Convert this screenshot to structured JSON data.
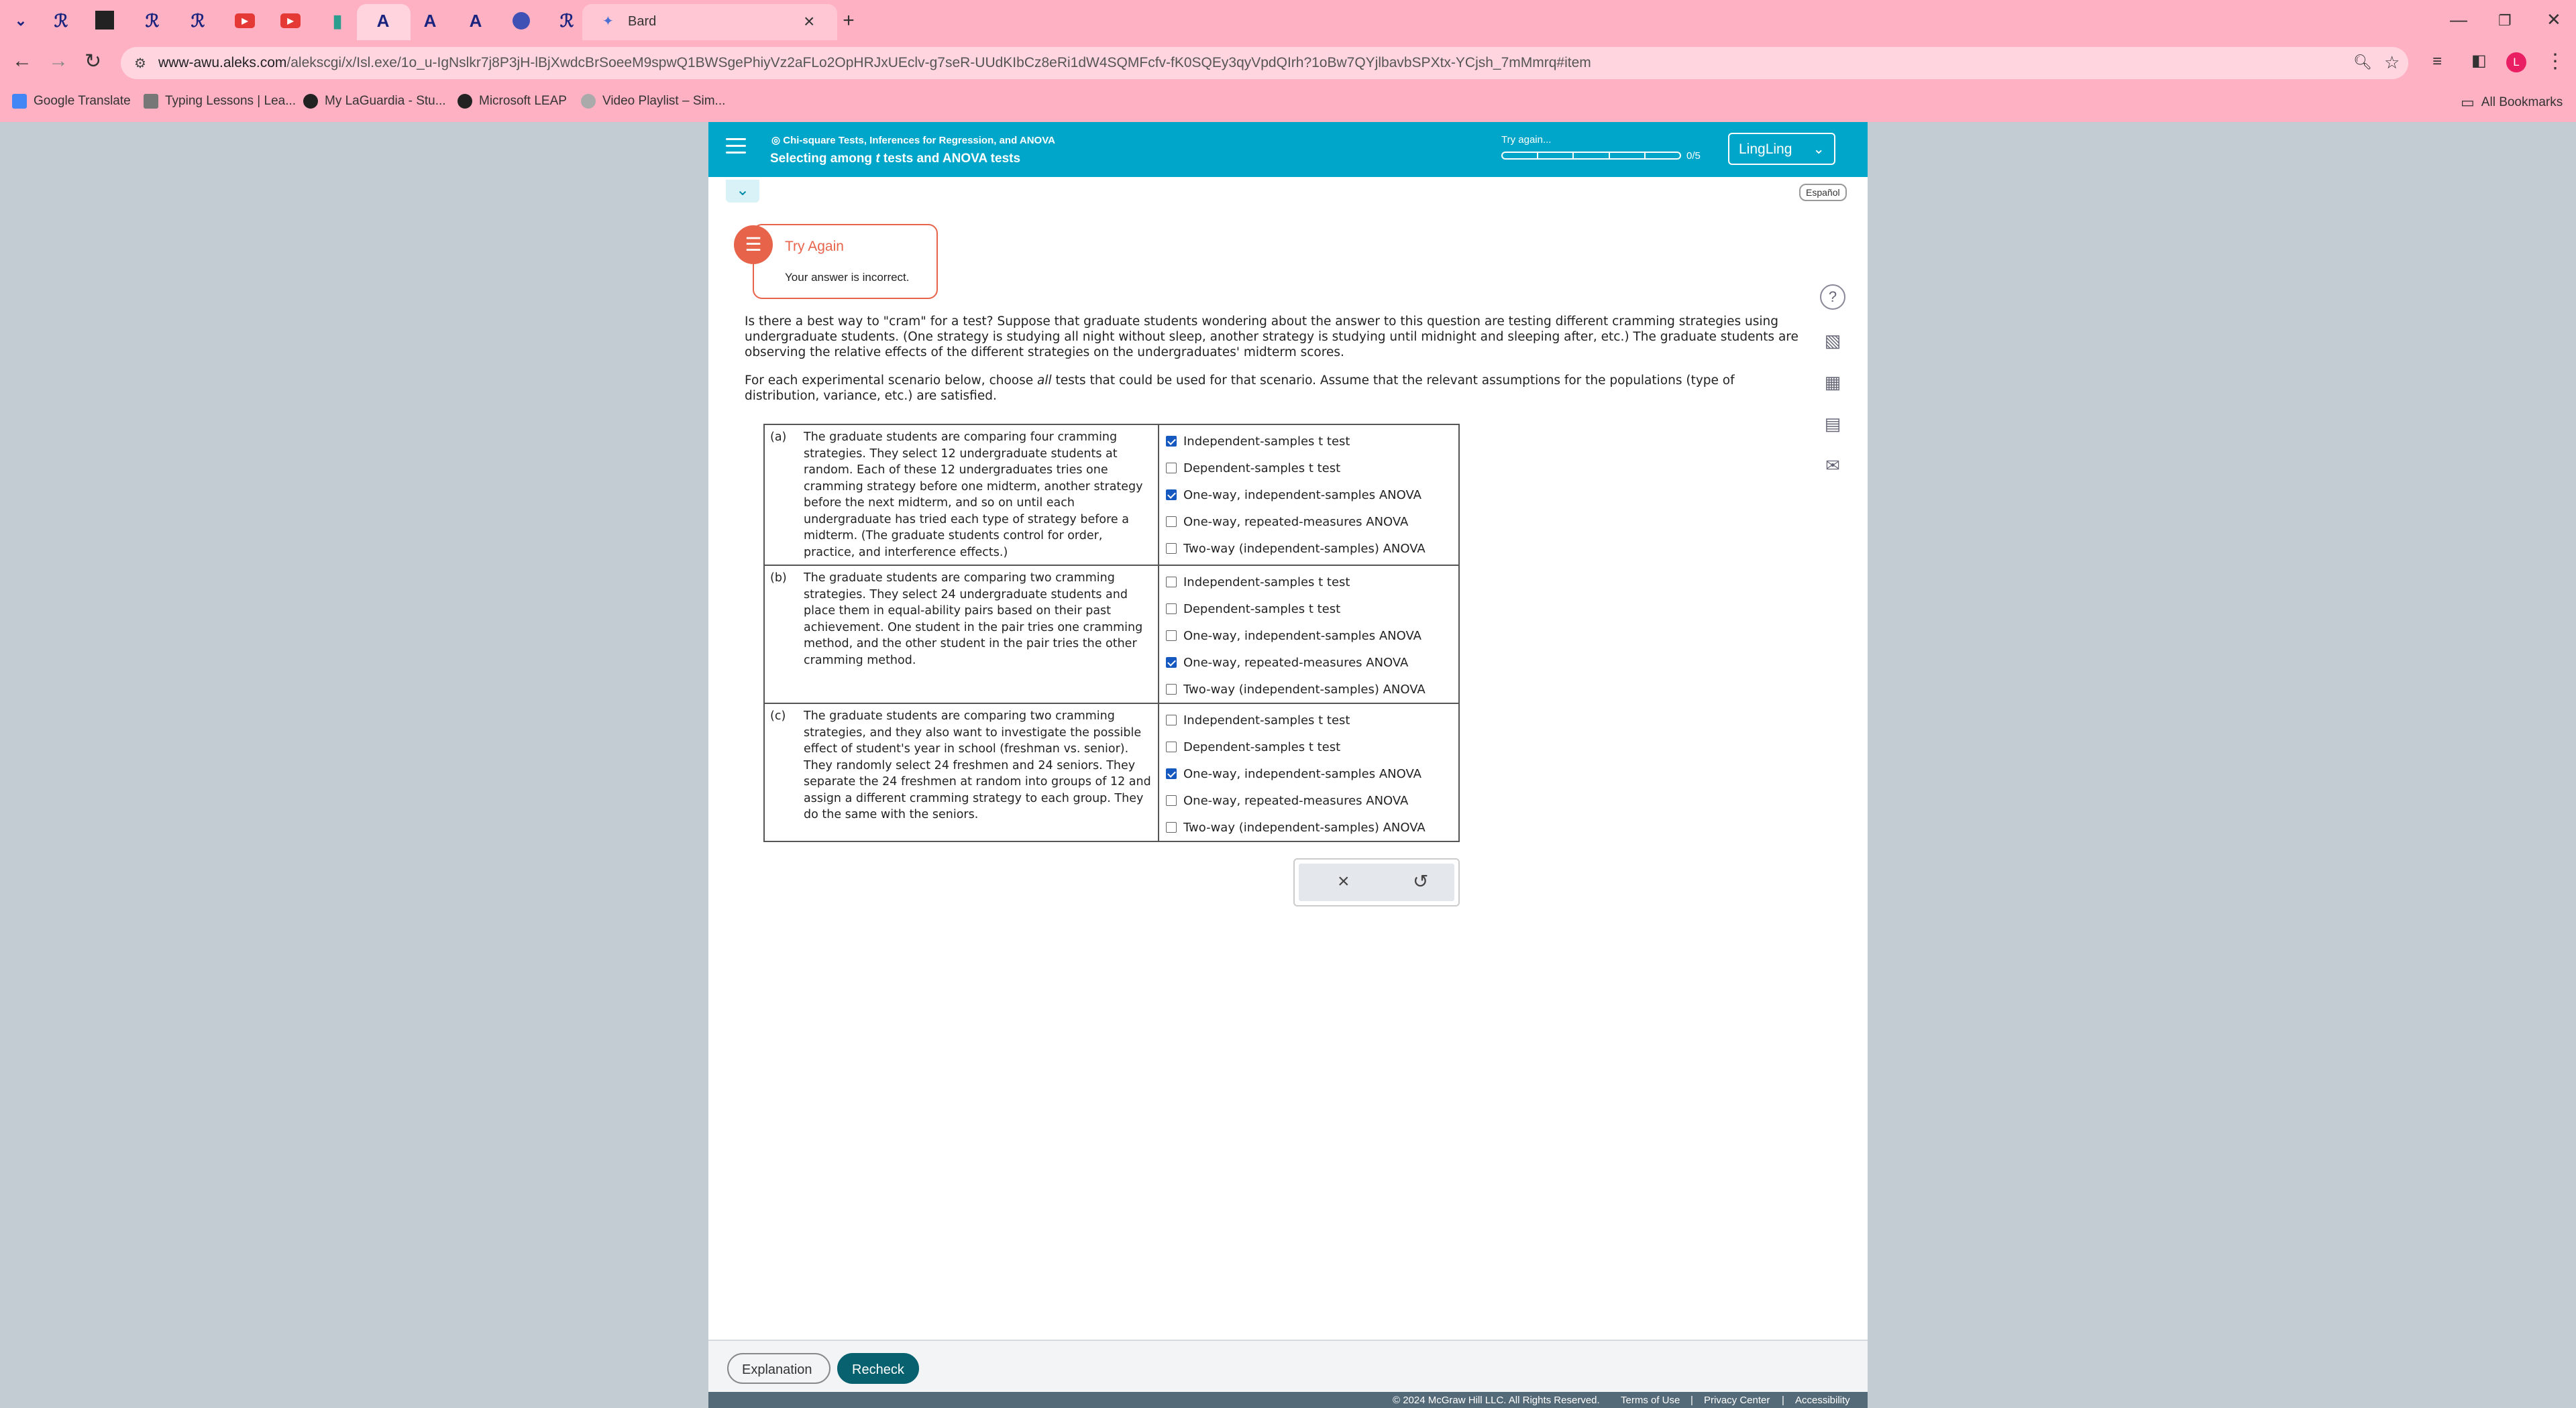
{
  "browser": {
    "tabs": [
      {
        "label": "Bard"
      }
    ],
    "url": {
      "host": "www-awu.aleks.com",
      "path": "/alekscgi/x/Isl.exe/1o_u-IgNslkr7j8P3jH-lBjXwdcBrSoeeM9spwQ1BWSgePhiyVz2aFLo2OpHRJxUEclv-g7seR-UUdKIbCz8eRi1dW4SQMFcfv-fK0SQEy3qyVpdQIrh?1oBw7QYjlbavbSPXtx-YCjsh_7mMmrq#item"
    },
    "bookmarks": [
      "Google Translate",
      "Typing Lessons | Lea...",
      "My LaGuardia - Stu...",
      "Microsoft LEAP",
      "Video Playlist – Sim..."
    ],
    "all_bookmarks": "All Bookmarks",
    "profile_initial": "L"
  },
  "header": {
    "topic": "Chi-square Tests, Inferences for Regression, and ANOVA",
    "title_pre": "Selecting among ",
    "title_t": "t",
    "title_post": " tests and ANOVA tests",
    "status": "Try again...",
    "progress": "0/5",
    "progress_value": 0,
    "user": "LingLing",
    "language": "Español"
  },
  "feedback": {
    "heading": "Try Again",
    "message": "Your answer is incorrect."
  },
  "question": {
    "intro": "Is there a best way to \"cram\" for a test? Suppose that graduate students wondering about the answer to this question are testing different cramming strategies using undergraduate students. (One strategy is studying all night without sleep, another strategy is studying until midnight and sleeping after, etc.) The graduate students are observing the relative effects of the different strategies on the undergraduates' midterm scores.",
    "instr_pre": "For each experimental scenario below, choose ",
    "instr_em": "all",
    "instr_post": " tests that could be used for that scenario. Assume that the relevant assumptions for the populations (type of distribution, variance, etc.) are satisfied."
  },
  "scenarios": [
    {
      "label": "(a)",
      "text": "The graduate students are comparing four cramming strategies. They select 12 undergraduate students at random. Each of these 12 undergraduates tries one cramming strategy before one midterm, another strategy before the next midterm, and so on until each undergraduate has tried each type of strategy before a midterm. (The graduate students control for order, practice, and interference effects.)",
      "options": [
        {
          "label": "Independent-samples t test",
          "checked": true
        },
        {
          "label": "Dependent-samples t test",
          "checked": false
        },
        {
          "label": "One-way, independent-samples ANOVA",
          "checked": true
        },
        {
          "label": "One-way, repeated-measures ANOVA",
          "checked": false
        },
        {
          "label": "Two-way (independent-samples) ANOVA",
          "checked": false
        }
      ]
    },
    {
      "label": "(b)",
      "text": "The graduate students are comparing two cramming strategies. They select 24 undergraduate students and place them in equal-ability pairs based on their past achievement. One student in the pair tries one cramming method, and the other student in the pair tries the other cramming method.",
      "options": [
        {
          "label": "Independent-samples t test",
          "checked": false
        },
        {
          "label": "Dependent-samples t test",
          "checked": false
        },
        {
          "label": "One-way, independent-samples ANOVA",
          "checked": false
        },
        {
          "label": "One-way, repeated-measures ANOVA",
          "checked": true
        },
        {
          "label": "Two-way (independent-samples) ANOVA",
          "checked": false
        }
      ]
    },
    {
      "label": "(c)",
      "text": "The graduate students are comparing two cramming strategies, and they also want to investigate the possible effect of student's year in school (freshman vs. senior). They randomly select 24 freshmen and 24 seniors. They separate the 24 freshmen at random into groups of 12 and assign a different cramming strategy to each group. They do the same with the seniors.",
      "options": [
        {
          "label": "Independent-samples t test",
          "checked": false
        },
        {
          "label": "Dependent-samples t test",
          "checked": false
        },
        {
          "label": "One-way, independent-samples ANOVA",
          "checked": true
        },
        {
          "label": "One-way, repeated-measures ANOVA",
          "checked": false
        },
        {
          "label": "Two-way (independent-samples) ANOVA",
          "checked": false
        }
      ]
    }
  ],
  "actions": {
    "clear": "×",
    "undo": "↺"
  },
  "buttons": {
    "explanation": "Explanation",
    "recheck": "Recheck"
  },
  "footer": {
    "copyright": "© 2024 McGraw Hill LLC. All Rights Reserved.",
    "terms": "Terms of Use",
    "privacy": "Privacy Center",
    "accessibility": "Accessibility"
  },
  "icons": {
    "help": "?",
    "sep": "|"
  }
}
